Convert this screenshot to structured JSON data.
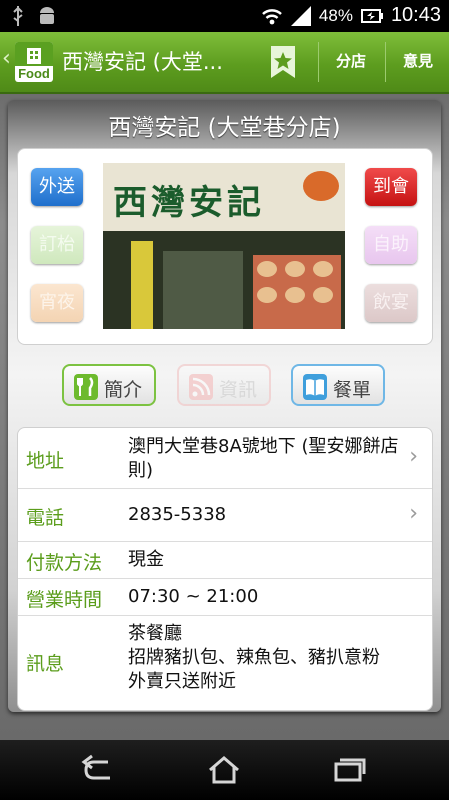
{
  "status_bar": {
    "time": "10:43",
    "battery_percent": "48%",
    "left_icons": [
      "usb-icon",
      "android-icon"
    ],
    "right_icons": [
      "wifi-icon",
      "signal-icon",
      "battery-charging-icon"
    ]
  },
  "action_bar": {
    "logo_text": "Food",
    "title": "西灣安記 (大堂...",
    "favorite_icon": "star-bookmark-icon",
    "branches_label": "分店",
    "feedback_label": "意見",
    "accent_color": "#5d9d1f"
  },
  "store": {
    "name": "西灣安記 (大堂巷分店)",
    "photo_sign_text": "西灣安記"
  },
  "services": {
    "left": [
      {
        "label": "外送",
        "active": true,
        "color": "#2f7fd6"
      },
      {
        "label": "訂枱",
        "active": false,
        "color": "#9ccf7d"
      },
      {
        "label": "宵夜",
        "active": false,
        "color": "#f1b678"
      }
    ],
    "right": [
      {
        "label": "到會",
        "active": true,
        "color": "#d81f1f"
      },
      {
        "label": "自助",
        "active": false,
        "color": "#d38ae0"
      },
      {
        "label": "飲宴",
        "active": false,
        "color": "#bb8a8a"
      }
    ]
  },
  "tabs": [
    {
      "label": "簡介",
      "icon": "fork-knife-icon",
      "state": "active",
      "border": "#7cc241"
    },
    {
      "label": "資訊",
      "icon": "rss-icon",
      "state": "disabled",
      "border": "#f0b3b3"
    },
    {
      "label": "餐單",
      "icon": "menu-book-icon",
      "state": "active",
      "border": "#6fb7e6"
    }
  ],
  "info": {
    "address": {
      "label": "地址",
      "value": "澳門大堂巷8A號地下 (聖安娜餅店則)"
    },
    "phone": {
      "label": "電話",
      "value": "2835-5338"
    },
    "payment": {
      "label": "付款方法",
      "value": "現金"
    },
    "hours": {
      "label": "營業時間",
      "value": "07:30 ~ 21:00"
    },
    "message": {
      "label": "訊息",
      "lines": [
        "茶餐廳",
        "招牌豬扒包、辣魚包、豬扒意粉",
        "外賣只送附近"
      ]
    }
  },
  "nav_bar": {
    "icons": [
      "back-icon",
      "home-icon",
      "recent-apps-icon"
    ]
  }
}
